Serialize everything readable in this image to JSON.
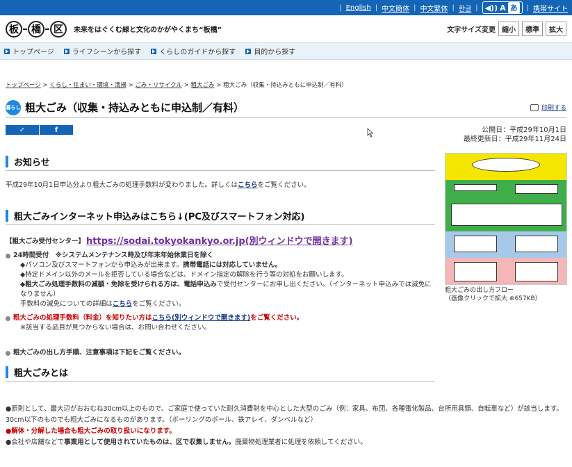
{
  "topbar": {
    "links": [
      "English",
      "中文簡体",
      "中文繁体",
      "한글"
    ],
    "voice": "A",
    "voice2": "あ",
    "mobile": "携帯サイト"
  },
  "header": {
    "logo_chars": [
      "板",
      "橋",
      "区"
    ],
    "tagline": "未来をはぐくむ緑と文化のかがやくまち“板橋”",
    "fontsize_label": "文字サイズ変更",
    "fontsize_buttons": [
      "縮小",
      "標準",
      "拡大"
    ]
  },
  "gnav": [
    "トップページ",
    "ライフシーンから探す",
    "くらしのガイドから探す",
    "目的から探す"
  ],
  "breadcrumb": {
    "items": [
      "トップページ",
      "くらし・住まい・環境・清掃",
      "ごみ・リサイクル",
      "粗大ごみ"
    ],
    "current": "粗大ごみ（収集・持込みともに申込制／有料）",
    "sep": ">"
  },
  "page": {
    "icon_text": "暮らし",
    "title": "粗大ごみ（収集・持込みともに申込制／有料）",
    "print": "印刷する"
  },
  "sns": {
    "twitter": "✓",
    "facebook": "f"
  },
  "dates": {
    "published": "公開日：平成29年10月1日",
    "updated": "最終更新日：平成29年11月24日"
  },
  "sec1": {
    "heading": "お知らせ",
    "text_a": "平成29年10月1日申込分より粗大ごみの処理手数料が変わりました。詳しくは",
    "link": "こちら",
    "text_b": "をご覧ください。"
  },
  "sec2": {
    "heading": "粗大ごみインターネット申込みはこちら↓(PC及びスマートフォン対応)",
    "center_label": "【粗大ごみ受付センター】",
    "center_link": "https://sodai.tokyokankyo.or.jp(別ウィンドウで開きます)",
    "b1_a": "24時間受付",
    "b1_b": "※システムメンテナンス時及び年末年始休業日を除く",
    "b1_l1a": "◆パソコン及びスマートフォンから申込みが出来ます。",
    "b1_l1b": "携帯電話には対応していません。",
    "b1_l2": "◆特定ドメイン以外のメールを拒否している場合などは、ドメイン指定の解除を行う等の対処をお願いします。",
    "b1_l3a": "◆粗大ごみ処理手数料の減額・免除を受けられる方は、電話申込み",
    "b1_l3b": "で受付センターにお申し出ください。（インターネット申込みでは減免になりません）",
    "b1_l4a": "手数料の減免についての詳細は",
    "b1_l4link": "こちら",
    "b1_l4b": "をご覧ください。",
    "b2_a": "粗大ごみの処理手数料（料金）を知りたい方は",
    "b2_link": "こちら(別ウィンドウで開きます)",
    "b2_b": "をご覧ください。",
    "b2_note": "※該当する品目が見つからない場合は、お問い合わせください。",
    "b3": "粗大ごみの出し方手順、注意事項は下記をご覧ください。"
  },
  "sec3": {
    "heading": "粗大ごみとは",
    "t1": "●原則として、最大辺がおおむね30cm以上のもので、ご家庭で使っていた耐久消費財を中心とした大型のごみ（例：家具、布団、各種電化製品、台所用具類、自転車など）が該当します。",
    "t2": "30cm以下のものでも粗大ごみになるものがあります。（ボーリングのボール、鉄アレイ、ダンベルなど）",
    "t3": "●解体・分解した場合も粗大ごみの取り扱いになります。",
    "t4a": "●会社や店舗などで",
    "t4b": "事業用として使用されていたものは、区で収集しません。",
    "t4c": "廃棄物処理業者に処理を依頼してください。"
  },
  "side": {
    "caption1": "粗大ごみの出し方フロー",
    "caption2": "（画像クリックで拡大",
    "size": "657KB）"
  }
}
